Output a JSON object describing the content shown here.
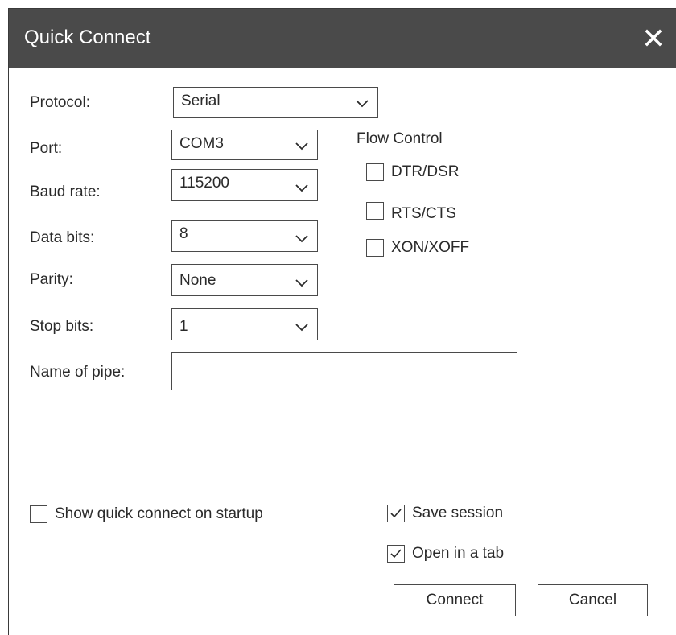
{
  "dialog": {
    "title": "Quick Connect",
    "close_icon": "close-icon"
  },
  "form": {
    "protocol": {
      "label": "Protocol:",
      "value": "Serial"
    },
    "port": {
      "label": "Port:",
      "value": "COM3"
    },
    "baud_rate": {
      "label": "Baud rate:",
      "value": "115200"
    },
    "data_bits": {
      "label": "Data bits:",
      "value": "8"
    },
    "parity": {
      "label": "Parity:",
      "value": "None"
    },
    "stop_bits": {
      "label": "Stop bits:",
      "value": "1"
    },
    "pipe_name": {
      "label": "Name of pipe:",
      "value": ""
    }
  },
  "flow_control": {
    "heading": "Flow Control",
    "options": [
      {
        "label": "DTR/DSR",
        "checked": false
      },
      {
        "label": "RTS/CTS",
        "checked": false
      },
      {
        "label": "XON/XOFF",
        "checked": false
      }
    ]
  },
  "options": {
    "show_on_startup": {
      "label": "Show quick connect on startup",
      "checked": false
    },
    "save_session": {
      "label": "Save session",
      "checked": true
    },
    "open_in_tab": {
      "label": "Open in a tab",
      "checked": true
    }
  },
  "buttons": {
    "connect": "Connect",
    "cancel": "Cancel"
  },
  "colors": {
    "titlebar": "#4a4a4a",
    "title_text": "#ffffff",
    "border": "#4a4a4a"
  }
}
